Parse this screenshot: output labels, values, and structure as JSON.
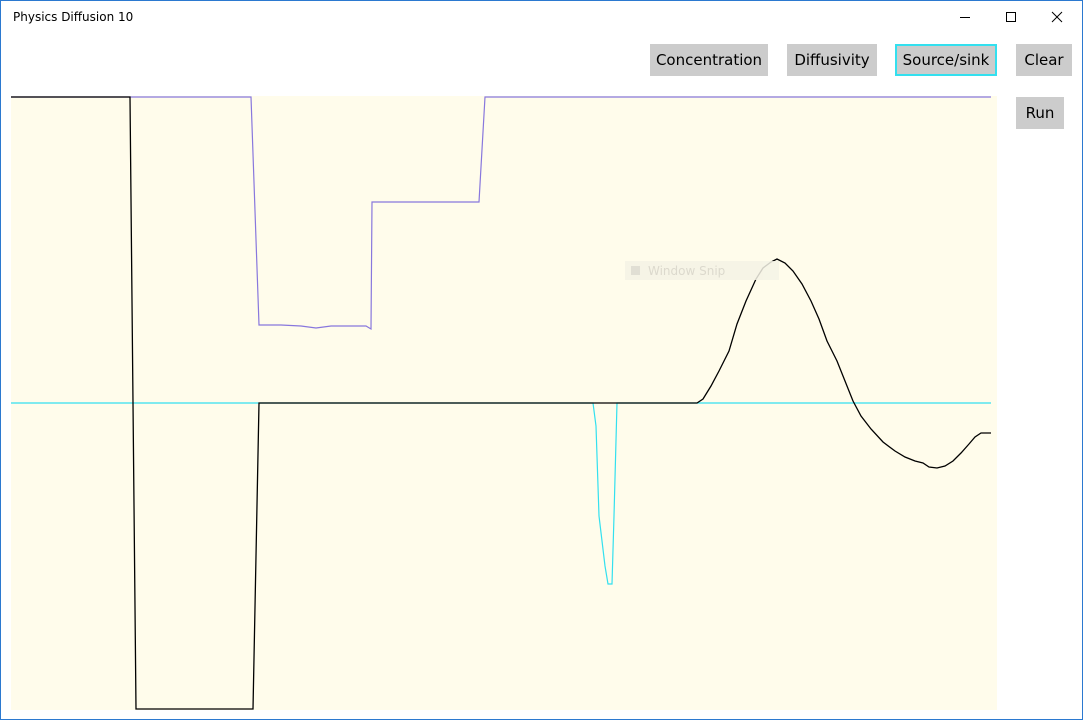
{
  "window": {
    "title": "Physics Diffusion 10",
    "controls": [
      "minimize-icon",
      "maximize-icon",
      "close-icon"
    ]
  },
  "toolbar": {
    "concentration_label": "Concentration",
    "diffusivity_label": "Diffusivity",
    "source_sink_label": "Source/sink",
    "clear_label": "Clear",
    "run_label": "Run",
    "selected": "Source/sink",
    "selected_border_color": "#33e0ef",
    "button_color": "#cccccc"
  },
  "overlay": {
    "window_snip_label": "Window Snip"
  },
  "plot": {
    "background_color": "#fffceb",
    "curves": [
      {
        "name": "Diffusivity",
        "color": "#8877dd"
      },
      {
        "name": "Source/sink",
        "color": "#33e0ef"
      },
      {
        "name": "Concentration",
        "color": "#000000"
      }
    ]
  }
}
